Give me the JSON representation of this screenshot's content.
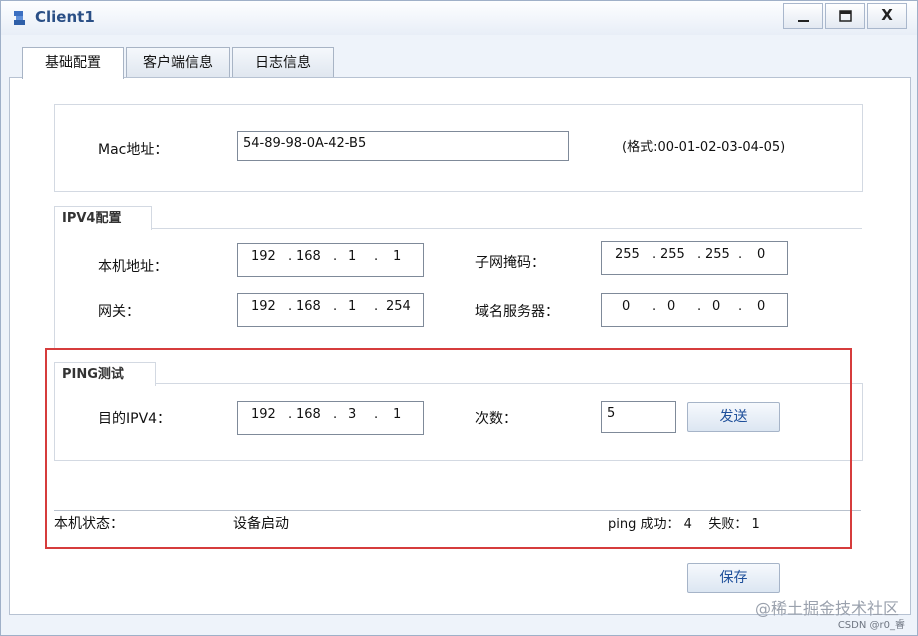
{
  "window": {
    "title": "Client1",
    "controls": {
      "minimize": "minimize",
      "maximize": "maximize",
      "close": "X"
    }
  },
  "tabs": [
    {
      "label": "基础配置",
      "active": true
    },
    {
      "label": "客户端信息",
      "active": false
    },
    {
      "label": "日志信息",
      "active": false
    }
  ],
  "mac": {
    "label": "Mac地址：",
    "value": "54-89-98-0A-42-B5",
    "format_hint": "(格式:00-01-02-03-04-05)"
  },
  "ipv4": {
    "group_title": "IPV4配置",
    "local_ip_label": "本机地址：",
    "local_ip": [
      "192",
      "168",
      "1",
      "1"
    ],
    "mask_label": "子网掩码：",
    "mask": [
      "255",
      "255",
      "255",
      "0"
    ],
    "gateway_label": "网关：",
    "gateway": [
      "192",
      "168",
      "1",
      "254"
    ],
    "dns_label": "域名服务器：",
    "dns": [
      "0",
      "0",
      "0",
      "0"
    ],
    "dot": "."
  },
  "ping": {
    "group_title": "PING测试",
    "dest_label": "目的IPV4：",
    "dest": [
      "192",
      "168",
      "3",
      "1"
    ],
    "count_label": "次数：",
    "count": "5",
    "send_label": "发送"
  },
  "status": {
    "label": "本机状态：",
    "value": "设备启动",
    "ping_result": "ping 成功： 4    失败： 1"
  },
  "save_label": "保存",
  "watermark": "@稀土掘金技术社区",
  "csdn_mark": "CSDN @r0_睿",
  "colors": {
    "accent": "#1e4f9a",
    "highlight_frame": "#d63c3c",
    "title": "#2a4f86"
  }
}
